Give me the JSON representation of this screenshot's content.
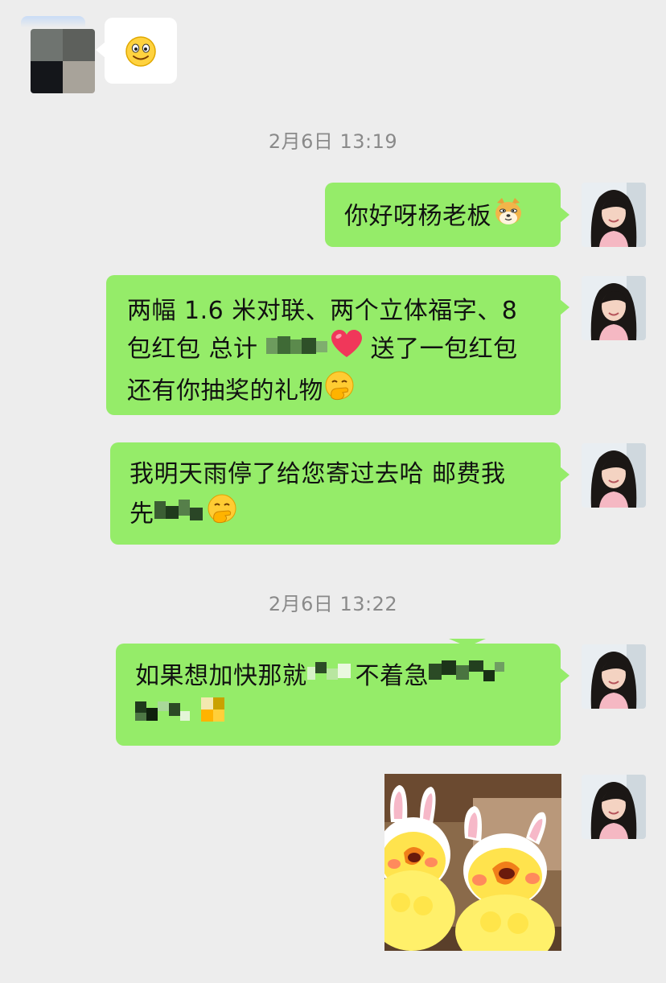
{
  "timestamps": [
    "2月6日 13:19",
    "2月6日 13:22"
  ],
  "messages": {
    "m1": {
      "text": "你好呀杨老板"
    },
    "m2": {
      "line1": "两幅 1.6 米对联、两个立体福字、8",
      "line2a": "包红包 总计",
      "line2b": "送了一包红包",
      "line3": "还有你抽奖的礼物"
    },
    "m3": {
      "line1": "我明天雨停了给您寄过去哈 邮费我",
      "line2": "先"
    },
    "m4": {
      "line1a": "如果想加快那就",
      "line1b": "不着急"
    }
  },
  "icons": {
    "contact_emoji": "smiley-emoji",
    "dog_emoji": "doge-emoji",
    "heart_emoji": "red-heart-emoji",
    "thinking_emoji": "face-with-hand-over-mouth-emoji",
    "sticker": "yellow-chick-bunny-ears-sticker"
  },
  "colors": {
    "background": "#ededed",
    "sent_bubble": "#95ec69",
    "received_bubble": "#ffffff",
    "timestamp_text": "#8a8a8a"
  }
}
